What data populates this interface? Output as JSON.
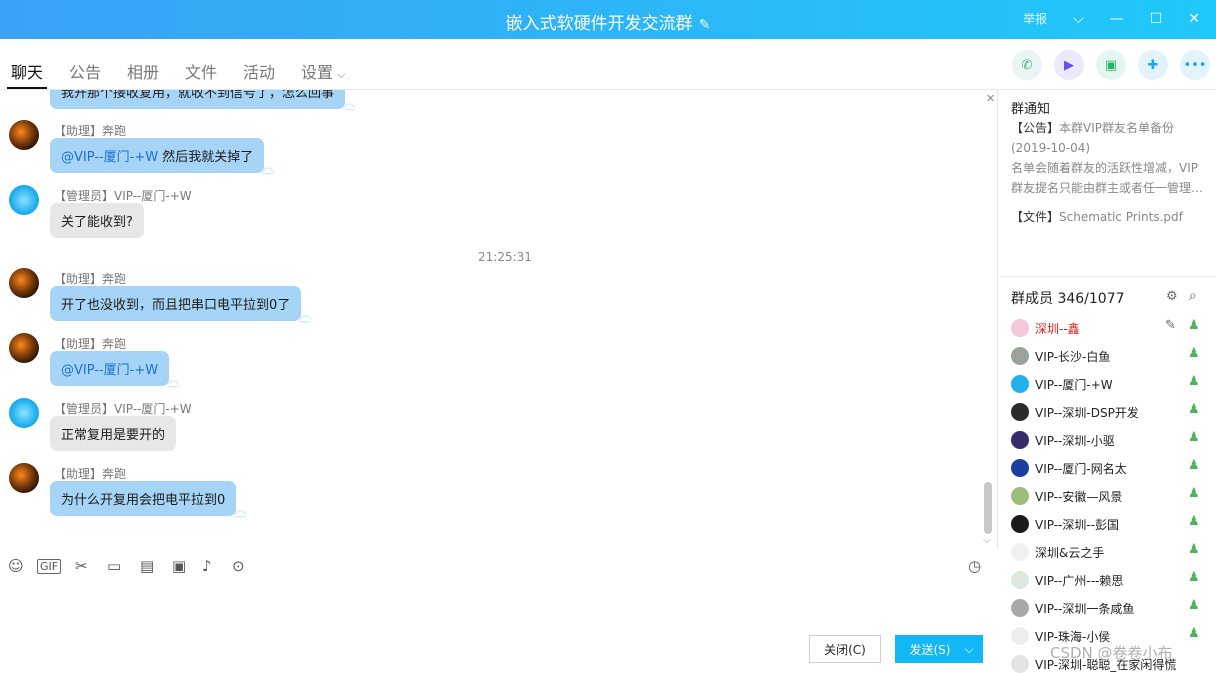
{
  "window": {
    "title": "嵌入式软硬件开发交流群",
    "report": "举报"
  },
  "tabs": [
    "聊天",
    "公告",
    "相册",
    "文件",
    "活动",
    "设置"
  ],
  "messages": [
    {
      "role": "assistant",
      "sender": "",
      "text": "我开那个接收复用，就收不到信号了，怎么回事"
    },
    {
      "role": "assistant",
      "sender": "【助理】奔跑",
      "mention": "@VIP--厦门-+W",
      "text": " 然后我就关掉了"
    },
    {
      "role": "admin",
      "sender": "【管理员】VIP--厦门-+W",
      "text": "关了能收到?"
    },
    {
      "role": "assistant",
      "sender": "【助理】奔跑",
      "text": "开了也没收到，而且把串口电平拉到0了"
    },
    {
      "role": "assistant",
      "sender": "【助理】奔跑",
      "mention": "@VIP--厦门-+W",
      "text": ""
    },
    {
      "role": "admin",
      "sender": "【管理员】VIP--厦门-+W",
      "text": "正常复用是要开的"
    },
    {
      "role": "assistant",
      "sender": "【助理】奔跑",
      "text": "为什么开复用会把电平拉到0"
    }
  ],
  "timestamp": "21:25:31",
  "composer": {
    "close_label": "关闭(C)",
    "send_label": "发送(S)"
  },
  "notice": {
    "title": "群通知",
    "announcement_tag": "【公告】",
    "announcement": "本群VIP群友名单备份(2019-10-04)",
    "announcement_detail": "名单会随着群友的活跃性增减，VIP群友提名只能由群主或者任一管理…",
    "file_tag": "【文件】",
    "file": "Schematic Prints.pdf"
  },
  "members": {
    "title": "群成员 346/1077",
    "list": [
      "深圳--鑫",
      "VIP-长沙-白鱼",
      "VIP--厦门-+W",
      "VIP--深圳-DSP开发",
      "VIP--深圳-小驱",
      "VIP--厦门-网名太",
      "VIP--安徽—风景",
      "VIP--深圳--彭国",
      "深圳&云之手",
      "VIP--广州---赖思",
      "VIP--深圳一条咸鱼",
      "VIP-珠海-小侯",
      "VIP-深圳-聪聪_在家闲得慌"
    ]
  },
  "watermark": "CSDN @卷卷小布",
  "colors": {
    "titlebar": "#3aa2f5",
    "bubble_blue": "#a6d4f6",
    "bubble_gray": "#e7e7e7",
    "send": "#12b7f5",
    "highlight_member": "#e02020"
  }
}
